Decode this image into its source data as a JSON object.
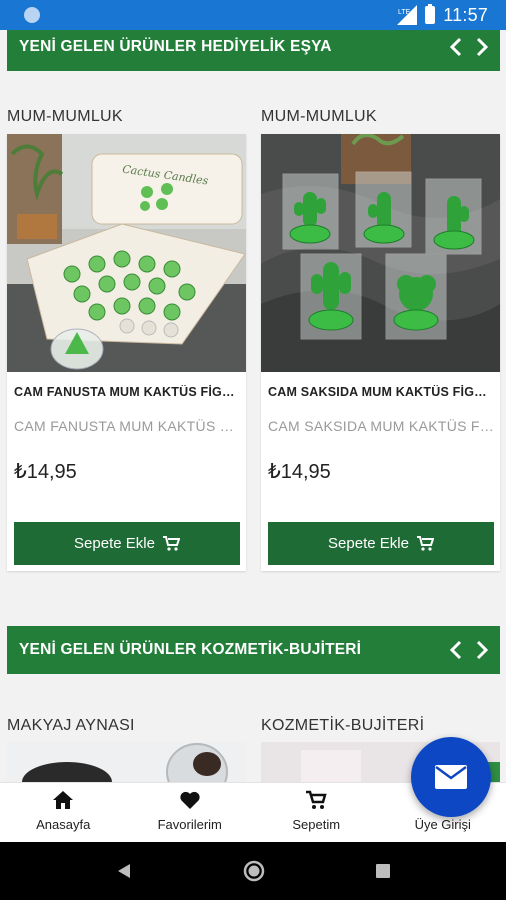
{
  "status_bar": {
    "time": "11:57",
    "network": "LTE"
  },
  "sections": [
    {
      "title": "YENİ GELEN ÜRÜNLER HEDİYELİK EŞYA",
      "products": [
        {
          "category": "MUM-MUMLUK",
          "name": "CAM FANUSTA MUM KAKTÜS FİGÜRLÜ",
          "description": "CAM FANUSTA MUM KAKTÜS FİGÜRLÜ",
          "price": "₺14,95",
          "button": "Sepete Ekle",
          "image_text": "Cactus Candles"
        },
        {
          "category": "MUM-MUMLUK",
          "name": "CAM SAKSIDA MUM KAKTÜS FİGÜRLÜ",
          "description": "CAM SAKSIDA MUM KAKTÜS FİGÜRLÜ",
          "price": "₺14,95",
          "button": "Sepete Ekle"
        }
      ]
    },
    {
      "title": "YENİ GELEN ÜRÜNLER KOZMETİK-BUJİTERİ",
      "products": [
        {
          "category": "MAKYAJ AYNASI"
        },
        {
          "category": "KOZMETİK-BUJİTERİ"
        }
      ]
    }
  ],
  "bottom_nav": [
    {
      "label": "Anasayfa",
      "icon": "home-icon"
    },
    {
      "label": "Favorilerim",
      "icon": "heart-icon"
    },
    {
      "label": "Sepetim",
      "icon": "cart-icon"
    },
    {
      "label": "Üye Girişi",
      "icon": "user-icon"
    }
  ],
  "colors": {
    "header_green": "#237e3a",
    "button_green": "#1e6b36",
    "status_blue": "#1976d2",
    "fab_blue": "#0d47c4"
  }
}
